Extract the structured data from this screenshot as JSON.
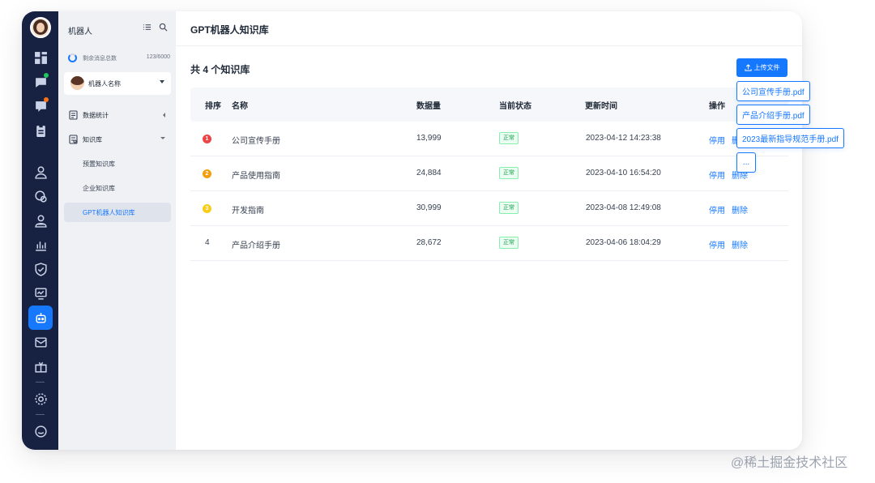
{
  "sidebar": {
    "title": "机器人",
    "usage_label": "剩余消息总数",
    "usage_count": "123/6000",
    "bot_name": "机器人名称",
    "items": [
      {
        "label": "数据统计"
      },
      {
        "label": "知识库"
      }
    ],
    "sub_items": [
      {
        "label": "预置知识库"
      },
      {
        "label": "企业知识库"
      },
      {
        "label": "GPT机器人知识库"
      }
    ]
  },
  "main": {
    "title": "GPT机器人知识库",
    "total": "共 4 个知识库",
    "upload_label": "上传文件"
  },
  "table": {
    "headers": [
      "排序",
      "名称",
      "数据量",
      "当前状态",
      "更新时间",
      "操作"
    ],
    "rows": [
      {
        "rank": "1",
        "name": "公司宣传手册",
        "count": "13,999",
        "status": "正常",
        "updated": "2023-04-12 14:23:38",
        "op1": "停用",
        "op2": "删除"
      },
      {
        "rank": "2",
        "name": "产品使用指南",
        "count": "24,884",
        "status": "正常",
        "updated": "2023-04-10 16:54:20",
        "op1": "停用",
        "op2": "删除"
      },
      {
        "rank": "3",
        "name": "开发指南",
        "count": "30,999",
        "status": "正常",
        "updated": "2023-04-08 12:49:08",
        "op1": "停用",
        "op2": "删除"
      },
      {
        "rank": "4",
        "name": "产品介绍手册",
        "count": "28,672",
        "status": "正常",
        "updated": "2023-04-06 18:04:29",
        "op1": "停用",
        "op2": "删除"
      }
    ]
  },
  "upload_files": [
    "公司宣传手册.pdf",
    "产品介绍手册.pdf",
    "2023最新指导规范手册.pdf",
    "..."
  ],
  "watermark": "@稀土掘金技术社区",
  "colors": {
    "rail": "#172142",
    "accent": "#1677ff",
    "rank1": "#ef4444",
    "rank2": "#f59e0b",
    "rank3": "#facc15",
    "status": "#16a34a"
  }
}
